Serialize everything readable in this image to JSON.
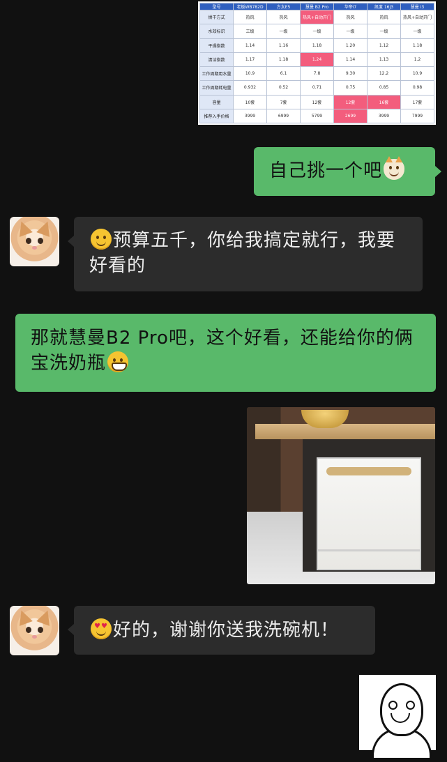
{
  "table": {
    "headers": [
      "型号",
      "老板WB782D",
      "方太E5",
      "慧曼 B2 Pro",
      "华帝i7",
      "凯度 16J3",
      "慧曼 i3"
    ],
    "rows": [
      {
        "label": "烘干方式",
        "cells": [
          "热风",
          "热风",
          "热风+自动开门",
          "热风",
          "热风",
          "热风+自动开门"
        ]
      },
      {
        "label": "水效标识",
        "cells": [
          "三级",
          "一级",
          "一级",
          "一级",
          "一级",
          "一级"
        ]
      },
      {
        "label": "干燥指数",
        "cells": [
          "1.14",
          "1.16",
          "1.18",
          "1.20",
          "1.12",
          "1.18"
        ]
      },
      {
        "label": "清洁指数",
        "cells": [
          "1.17",
          "1.18",
          "1.24",
          "1.14",
          "1.13",
          "1.2"
        ]
      },
      {
        "label": "工作周期用水量",
        "cells": [
          "10.9",
          "6.1",
          "7.8",
          "9.30",
          "12.2",
          "10.9"
        ]
      },
      {
        "label": "工作周期耗电量",
        "cells": [
          "0.932",
          "0.52",
          "0.71",
          "0.75",
          "0.85",
          "0.98"
        ]
      },
      {
        "label": "容量",
        "cells": [
          "10套",
          "7套",
          "12套",
          "12套",
          "16套",
          "17套"
        ]
      },
      {
        "label": "推荐入手价格",
        "cells": [
          "3999",
          "6999",
          "5799",
          "2699",
          "3999",
          "7999"
        ]
      }
    ],
    "highlight_color": "#f35d7d"
  },
  "messages": [
    {
      "id": "m1",
      "side": "sent",
      "text": "自己挑一个吧",
      "emoji": "cat-face"
    },
    {
      "id": "m2",
      "side": "received",
      "emoji": "smiling-face",
      "text": "预算五千，你给我搞定就行，我要好看的"
    },
    {
      "id": "m3",
      "side": "sent",
      "text": "那就慧曼B2 Pro吧，这个好看，还能给你的俩宝洗奶瓶",
      "emoji": "grinning-face"
    },
    {
      "id": "m4",
      "side": "sent",
      "type": "image",
      "subject": "dishwasher-photo"
    },
    {
      "id": "m5",
      "side": "received",
      "emoji": "heart-eyes-face",
      "text": "好的，谢谢你送我洗碗机！"
    },
    {
      "id": "m6",
      "side": "sent",
      "type": "sticker",
      "subject": "laughing-face-sticker"
    }
  ],
  "colors": {
    "background": "#111111",
    "sent_bubble": "#59b96a",
    "received_bubble": "#2c2c2c"
  }
}
